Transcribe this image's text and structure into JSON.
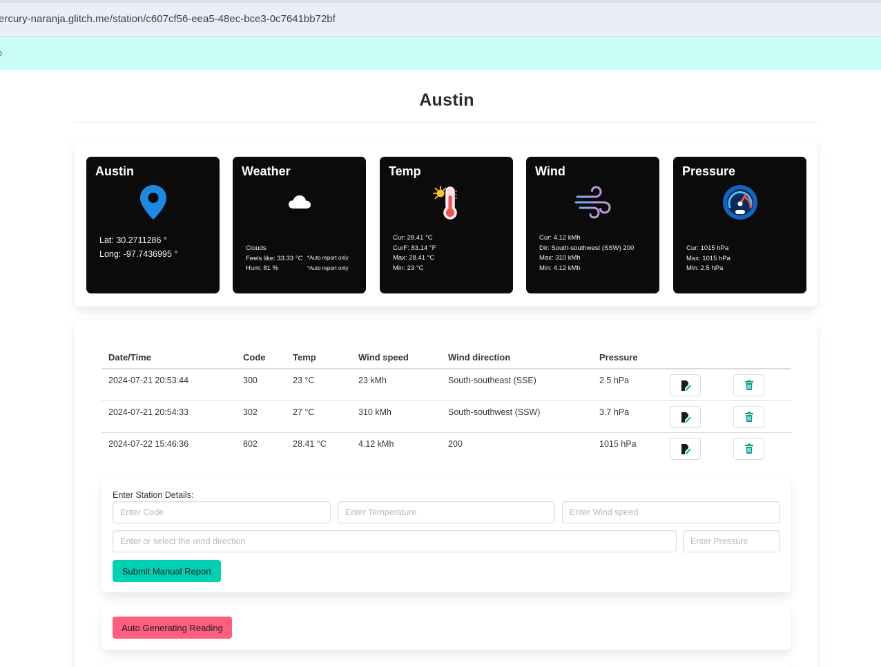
{
  "browser": {
    "url": "ercury-naranja.glitch.me/station/c607cf56-eea5-48ec-bce3-0c7641bb72bf",
    "banner_mark": "o"
  },
  "station": {
    "title": "Austin"
  },
  "cards": {
    "location": {
      "title": "Austin",
      "lat": "Lat: 30.2711286 °",
      "long": "Long: -97.7436995 °",
      "icon": "map-pin-icon"
    },
    "weather": {
      "title": "Weather",
      "condition": "Clouds",
      "feels_like": "Feels like: 33.33 °C",
      "humidity": "Hum: 81 %",
      "auto_note_1": "*Auto report only",
      "auto_note_2": "*Auto report only",
      "icon": "cloud-icon"
    },
    "temp": {
      "title": "Temp",
      "cur": "Cur: 28.41 °C",
      "curf": "CurF: 83.14 °F",
      "max": "Max: 28.41 °C",
      "min": "Min: 23 °C",
      "icon": "thermometer-sun-icon"
    },
    "wind": {
      "title": "Wind",
      "cur": "Cur: 4.12 kMh",
      "dir": "Dir: South-southwest (SSW) 200",
      "max": "Max: 310 kMh",
      "min": "Min: 4.12 kMh",
      "icon": "wind-icon"
    },
    "pressure": {
      "title": "Pressure",
      "cur": "Cur: 1015 hPa",
      "max": "Max: 1015 hPa",
      "min": "Min: 2.5 hPa",
      "icon": "gauge-icon"
    }
  },
  "table": {
    "headers": {
      "datetime": "Date/Time",
      "code": "Code",
      "temp": "Temp",
      "wind_speed": "Wind speed",
      "wind_direction": "Wind direction",
      "pressure": "Pressure"
    },
    "rows": [
      {
        "datetime": "2024-07-21 20:53:44",
        "code": "300",
        "temp": "23 °C",
        "wind_speed": "23 kMh",
        "wind_direction": "South-southeast (SSE)",
        "pressure": "2.5 hPa"
      },
      {
        "datetime": "2024-07-21 20:54:33",
        "code": "302",
        "temp": "27 °C",
        "wind_speed": "310 kMh",
        "wind_direction": "South-southwest (SSW)",
        "pressure": "3.7 hPa"
      },
      {
        "datetime": "2024-07-22 15:46:36",
        "code": "802",
        "temp": "28.41 °C",
        "wind_speed": "4.12 kMh",
        "wind_direction": "200",
        "pressure": "1015 hPa"
      }
    ],
    "edit_icon": "edit-icon",
    "delete_icon": "trash-icon"
  },
  "form": {
    "label": "Enter Station Details:",
    "code_placeholder": "Enter Code",
    "temp_placeholder": "Enter Temperature",
    "wind_speed_placeholder": "Enter Wind speed",
    "wind_direction_placeholder": "Enter or select the wind direction",
    "pressure_placeholder": "Enter Pressure",
    "submit_label": "Submit Manual Report"
  },
  "auto": {
    "button_label": "Auto Generating Reading"
  },
  "colors": {
    "primary": "#00d1b2",
    "danger": "#ff5f7f",
    "banner": "#c9fdf6",
    "card_bg": "#0b0b0b",
    "edit_icon_color": "#00b89c",
    "trash_icon_color": "#00a388"
  }
}
